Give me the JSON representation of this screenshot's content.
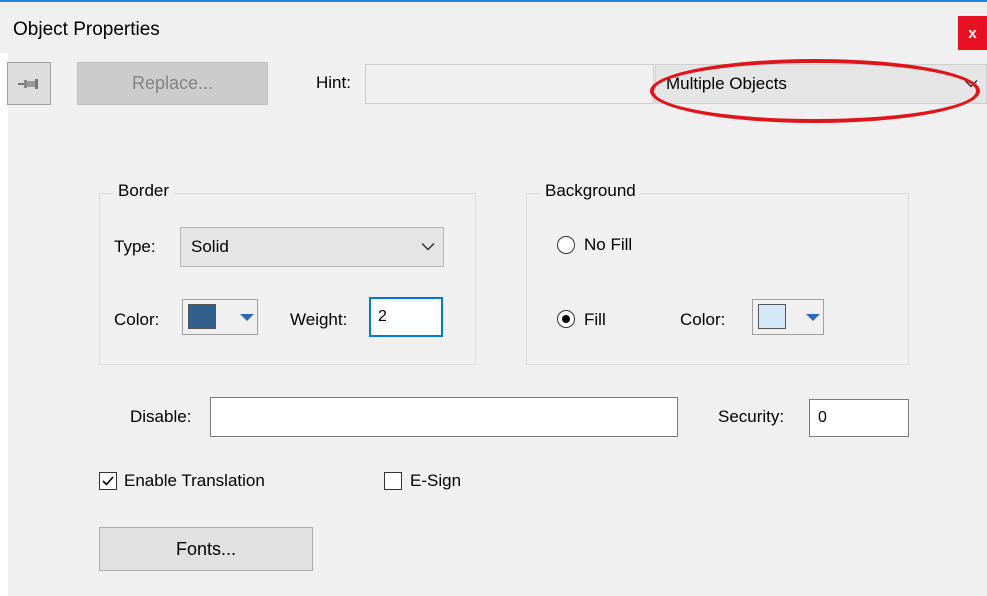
{
  "window": {
    "title": "Object Properties",
    "close_glyph": "x"
  },
  "toolbar": {
    "pin_icon": "pushpin-icon",
    "replace_label": "Replace...",
    "hint_label": "Hint:",
    "hint_value": "",
    "object_select": "Multiple Objects"
  },
  "border": {
    "title": "Border",
    "type_label": "Type:",
    "type_value": "Solid",
    "color_label": "Color:",
    "color": "#2f5f8a",
    "weight_label": "Weight:",
    "weight_value": "2"
  },
  "background": {
    "title": "Background",
    "no_fill_label": "No Fill",
    "fill_label": "Fill",
    "fill_selected": true,
    "color_label": "Color:",
    "color": "#d4e8f8"
  },
  "disable_label": "Disable:",
  "disable_value": "",
  "security_label": "Security:",
  "security_value": "0",
  "enable_translation": {
    "label": "Enable Translation",
    "checked": true
  },
  "esign": {
    "label": "E-Sign",
    "checked": false
  },
  "fonts_label": "Fonts...",
  "annotation_color": "#e0151b"
}
